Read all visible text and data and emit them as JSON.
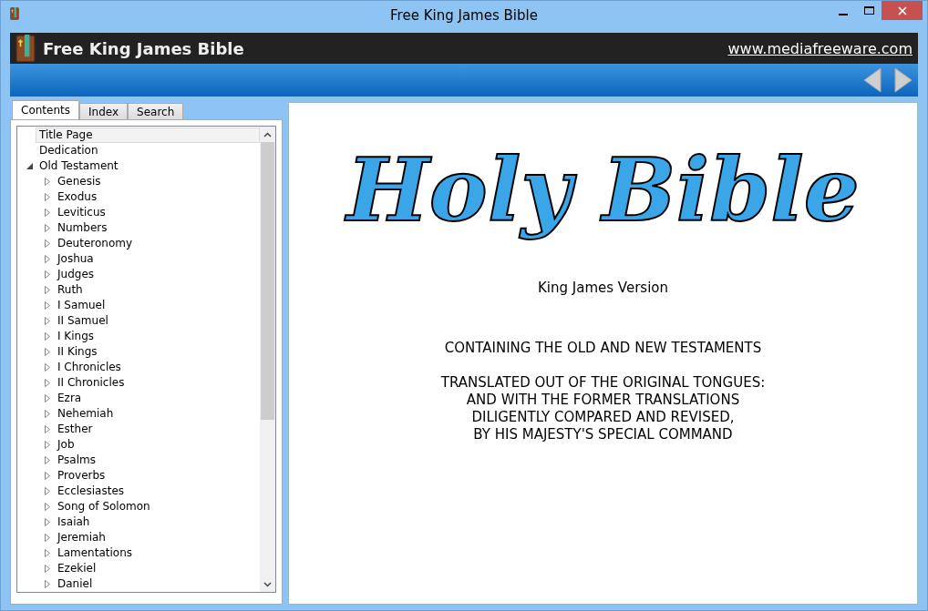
{
  "window": {
    "title": "Free King James Bible"
  },
  "header": {
    "title": "Free King James Bible",
    "link": "www.mediafreeware.com"
  },
  "tabs": [
    {
      "label": "Contents",
      "selected": true
    },
    {
      "label": "Index",
      "selected": false
    },
    {
      "label": "Search",
      "selected": false
    }
  ],
  "tree": [
    {
      "label": "Title Page",
      "selected": true
    },
    {
      "label": "Dedication",
      "selected": false
    },
    {
      "label": "Old Testament",
      "selected": false,
      "expanded": true,
      "children": [
        {
          "label": "Genesis",
          "selected": false,
          "expanded": false
        },
        {
          "label": "Exodus",
          "selected": false,
          "expanded": false
        },
        {
          "label": "Leviticus",
          "selected": false,
          "expanded": false
        },
        {
          "label": "Numbers",
          "selected": false,
          "expanded": false
        },
        {
          "label": "Deuteronomy",
          "selected": false,
          "expanded": false
        },
        {
          "label": "Joshua",
          "selected": false,
          "expanded": false
        },
        {
          "label": "Judges",
          "selected": false,
          "expanded": false
        },
        {
          "label": "Ruth",
          "selected": false,
          "expanded": false
        },
        {
          "label": "I Samuel",
          "selected": false,
          "expanded": false
        },
        {
          "label": "II Samuel",
          "selected": false,
          "expanded": false
        },
        {
          "label": "I Kings",
          "selected": false,
          "expanded": false
        },
        {
          "label": "II Kings",
          "selected": false,
          "expanded": false
        },
        {
          "label": "I Chronicles",
          "selected": false,
          "expanded": false
        },
        {
          "label": "II Chronicles",
          "selected": false,
          "expanded": false
        },
        {
          "label": "Ezra",
          "selected": false,
          "expanded": false
        },
        {
          "label": "Nehemiah",
          "selected": false,
          "expanded": false
        },
        {
          "label": "Esther",
          "selected": false,
          "expanded": false
        },
        {
          "label": "Job",
          "selected": false,
          "expanded": false
        },
        {
          "label": "Psalms",
          "selected": false,
          "expanded": false
        },
        {
          "label": "Proverbs",
          "selected": false,
          "expanded": false
        },
        {
          "label": "Ecclesiastes",
          "selected": false,
          "expanded": false
        },
        {
          "label": "Song of Solomon",
          "selected": false,
          "expanded": false
        },
        {
          "label": "Isaiah",
          "selected": false,
          "expanded": false
        },
        {
          "label": "Jeremiah",
          "selected": false,
          "expanded": false
        },
        {
          "label": "Lamentations",
          "selected": false,
          "expanded": false
        },
        {
          "label": "Ezekiel",
          "selected": false,
          "expanded": false
        },
        {
          "label": "Daniel",
          "selected": false,
          "expanded": false
        }
      ]
    }
  ],
  "page": {
    "logo": "Holy Bible",
    "version": "King James Version",
    "lines": [
      "CONTAINING THE OLD AND NEW TESTAMENTS",
      "TRANSLATED OUT OF THE ORIGINAL TONGUES:",
      "AND WITH THE FORMER TRANSLATIONS",
      "DILIGENTLY COMPARED AND REVISED,",
      "BY HIS MAJESTY'S SPECIAL COMMAND"
    ]
  }
}
